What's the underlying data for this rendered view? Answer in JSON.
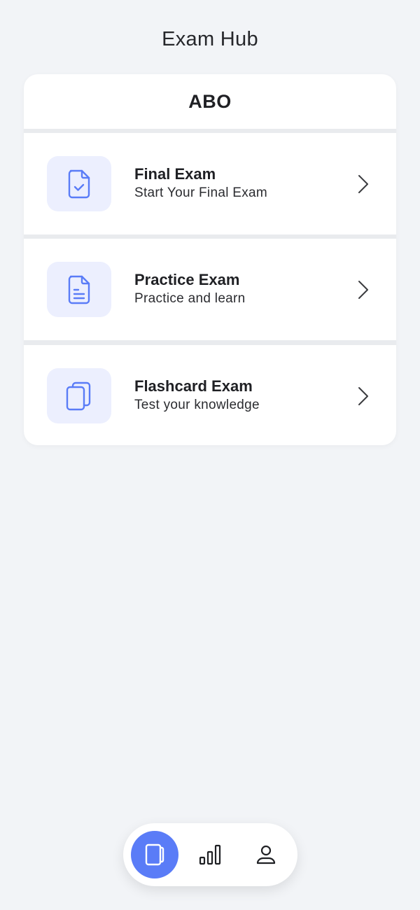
{
  "header": {
    "title": "Exam Hub"
  },
  "card": {
    "heading": "ABO",
    "items": [
      {
        "title": "Final Exam",
        "subtitle": "Start Your Final Exam",
        "icon": "document-check-icon"
      },
      {
        "title": "Practice Exam",
        "subtitle": "Practice and learn",
        "icon": "document-text-icon"
      },
      {
        "title": "Flashcard Exam",
        "subtitle": "Test your knowledge",
        "icon": "flashcards-icon"
      }
    ]
  },
  "bottom_nav": {
    "items": [
      {
        "icon": "exams-icon",
        "active": true
      },
      {
        "icon": "stats-icon",
        "active": false
      },
      {
        "icon": "profile-icon",
        "active": false
      }
    ]
  },
  "colors": {
    "accent": "#5a7cf7",
    "icon_bg": "#eceffe",
    "background": "#f2f4f7"
  }
}
